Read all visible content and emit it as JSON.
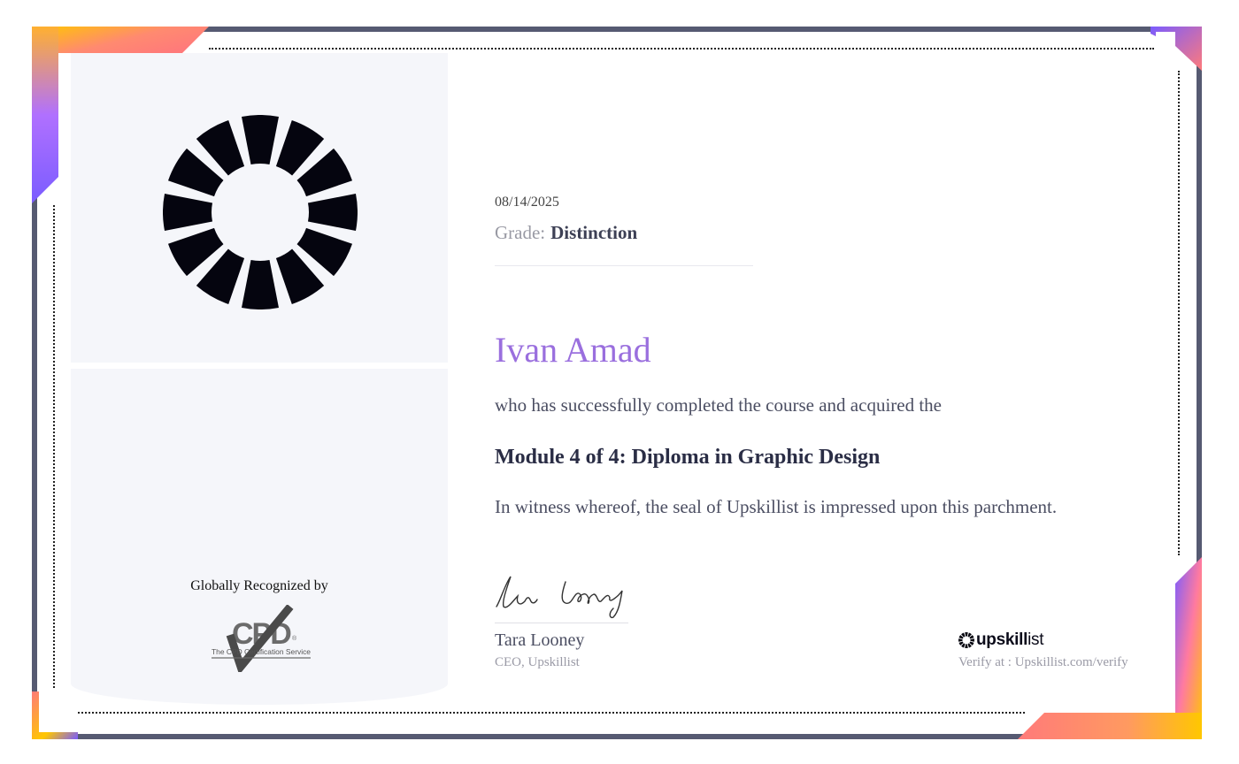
{
  "certificate": {
    "date": "08/14/2025",
    "grade_label": "Grade:",
    "grade_value": "Distinction",
    "recipient": "Ivan Amad",
    "statement": "who has successfully completed the course and acquired the",
    "course": "Module 4 of 4: Diploma in Graphic Design",
    "witness": "In witness whereof, the seal of Upskillist is impressed upon this parchment."
  },
  "left_panel": {
    "recognized_text": "Globally Recognized by",
    "cpd_logo_text": "The CPD Certification Service",
    "logo_icon": "upskillist-ring-icon"
  },
  "signatory": {
    "signature_text": "Tara Looney",
    "name": "Tara Looney",
    "title": "CEO, Upskillist"
  },
  "brand": {
    "name_bold": "upskill",
    "name_light": "ist",
    "verify_text": "Verify at : Upskillist.com/verify"
  },
  "colors": {
    "frame": "#565a72",
    "accent_purple": "#9a6fde",
    "gradient_yellow": "#ffc700",
    "gradient_coral": "#ff7a7a",
    "gradient_violet": "#7a5cff"
  }
}
